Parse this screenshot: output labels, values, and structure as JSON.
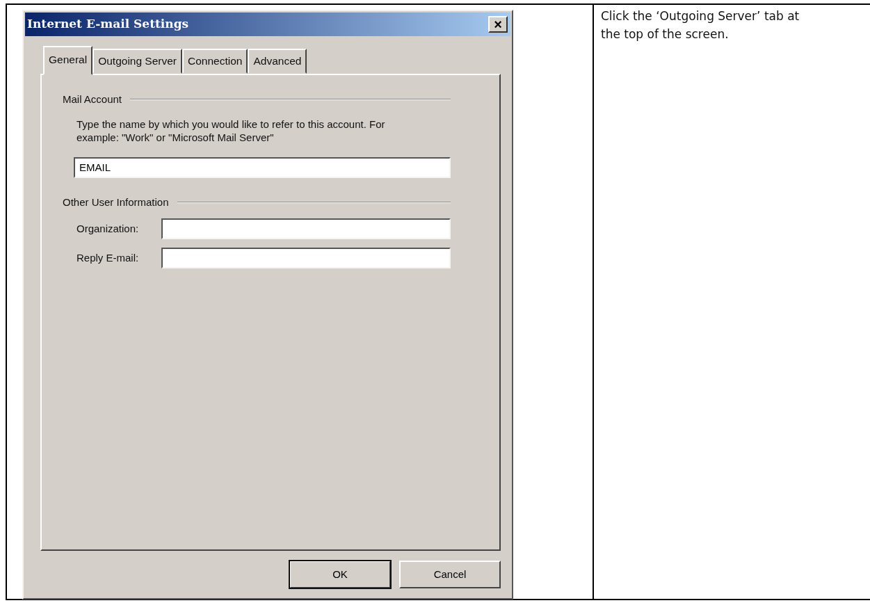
{
  "dialog": {
    "title": "Internet E-mail Settings",
    "close": "×",
    "tabs": [
      {
        "label": "General",
        "selected": true
      },
      {
        "label": "Outgoing Server",
        "selected": false
      },
      {
        "label": "Connection",
        "selected": false
      },
      {
        "label": "Advanced",
        "selected": false
      }
    ],
    "groups": [
      {
        "title": "Mail Account",
        "description": "Type the name by which you would like to refer to this account.  For example: \"Work\" or \"Microsoft Mail Server\"",
        "fields": [
          {
            "value": "EMAIL"
          }
        ]
      },
      {
        "title": "Other User Information",
        "fields": [
          {
            "label": "Organization:"
          },
          {
            "label": "Reply E-mail:"
          }
        ]
      }
    ],
    "buttons": [
      {
        "label": "OK",
        "default": true
      },
      {
        "label": "Cancel",
        "default": false
      }
    ]
  },
  "instruction": "Click the ‘Outgoing Server’ tab at the top of the screen."
}
